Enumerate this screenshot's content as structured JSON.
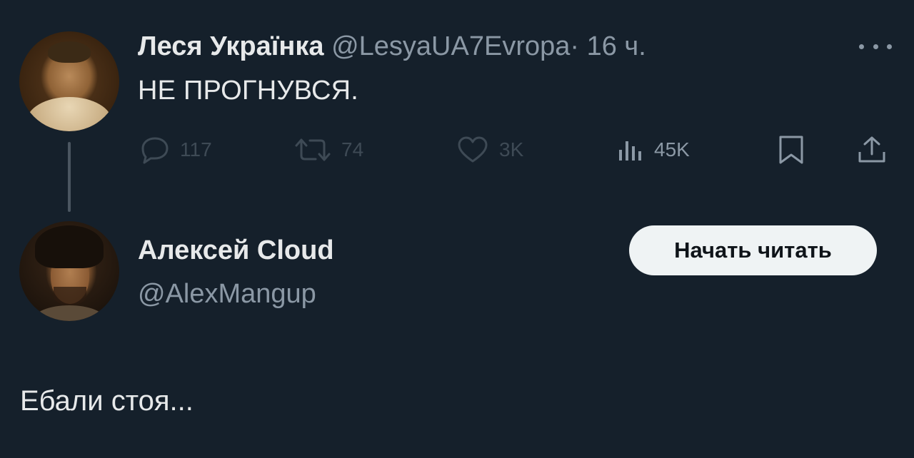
{
  "tweet": {
    "author": {
      "display_name": "Леся Українка",
      "handle": "@LesyaUA7Evropa",
      "separator": "·",
      "time": "16 ч."
    },
    "text": "НЕ ПРОГНУВСЯ.",
    "actions": {
      "replies": "117",
      "retweets": "74",
      "likes": "3K",
      "views": "45K"
    },
    "icons": [
      "more-icon",
      "reply-icon",
      "retweet-icon",
      "like-icon",
      "views-icon",
      "bookmark-icon",
      "share-icon"
    ]
  },
  "reply": {
    "author": {
      "display_name": "Алексей Cloud",
      "handle": "@AlexMangup"
    },
    "follow_button_label": "Начать читать",
    "text": "Ебали стоя..."
  },
  "colors": {
    "background": "#15202b",
    "primary_text": "#e7e9ea",
    "secondary_text": "#8b98a5",
    "button_bg": "#eff3f4",
    "button_text": "#0f1419"
  }
}
